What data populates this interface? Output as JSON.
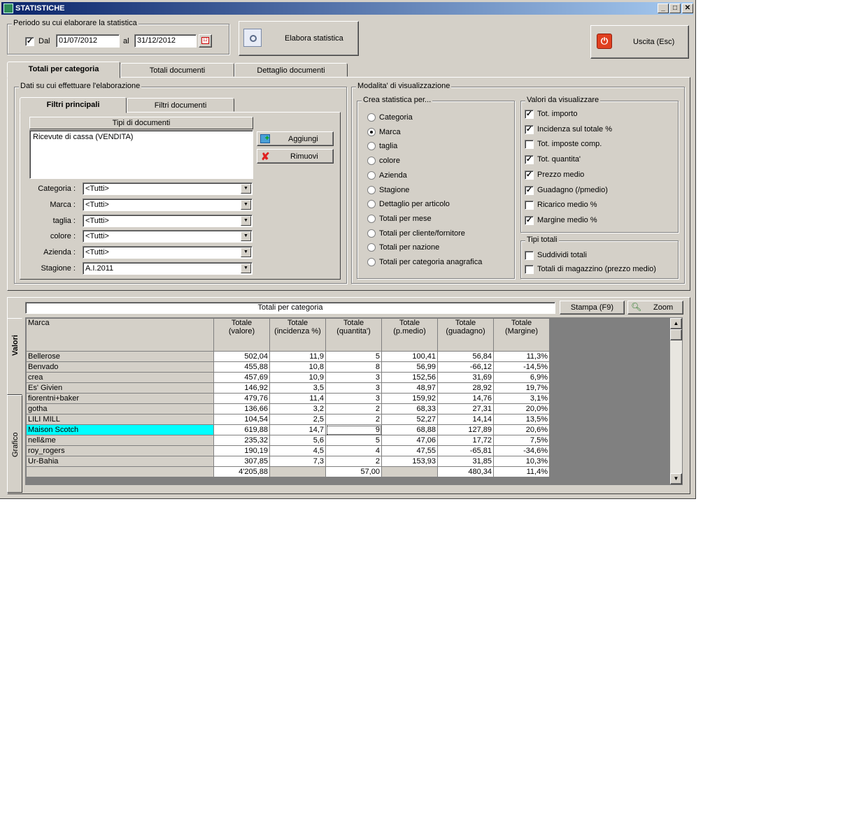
{
  "window": {
    "title": "STATISTICHE"
  },
  "period": {
    "group_label": "Periodo su cui elaborare la statistica",
    "from_label": "Dal",
    "from_checked": true,
    "from_value": "01/07/2012",
    "to_label": "al",
    "to_value": "31/12/2012"
  },
  "buttons": {
    "elabora": "Elabora statistica",
    "uscita": "Uscita (Esc)"
  },
  "main_tabs": [
    "Totali per categoria",
    "Totali documenti",
    "Dettaglio documenti"
  ],
  "dati": {
    "group_label": "Dati su cui effettuare l'elaborazione",
    "subtabs": [
      "Filtri principali",
      "Filtri documenti"
    ],
    "tipi_header": "Tipi di documenti",
    "tipi_items": [
      "Ricevute di cassa (VENDITA)"
    ],
    "aggiungi": "Aggiungi",
    "rimuovi": "Rimuovi",
    "filters": [
      {
        "label": "Categoria :",
        "value": "<Tutti>"
      },
      {
        "label": "Marca :",
        "value": "<Tutti>"
      },
      {
        "label": "taglia :",
        "value": "<Tutti>"
      },
      {
        "label": "colore :",
        "value": "<Tutti>"
      },
      {
        "label": "Azienda :",
        "value": "<Tutti>"
      },
      {
        "label": "Stagione :",
        "value": "A.I.2011"
      }
    ]
  },
  "modalita": {
    "group_label": "Modalita' di visualizzazione",
    "crea_label": "Crea statistica per...",
    "crea_options": [
      "Categoria",
      "Marca",
      "taglia",
      "colore",
      "Azienda",
      "Stagione",
      "Dettaglio per articolo",
      "Totali per mese",
      "Totali per cliente/fornitore",
      "Totali per nazione",
      "Totali per categoria anagrafica"
    ],
    "crea_selected": 1,
    "valori_label": "Valori da visualizzare",
    "valori_options": [
      {
        "label": "Tot. importo",
        "checked": true
      },
      {
        "label": "Incidenza sul totale %",
        "checked": true
      },
      {
        "label": "Tot. imposte comp.",
        "checked": false
      },
      {
        "label": "Tot. quantita'",
        "checked": true
      },
      {
        "label": "Prezzo medio",
        "checked": true
      },
      {
        "label": "Guadagno (/pmedio)",
        "checked": true
      },
      {
        "label": "Ricarico medio %",
        "checked": false
      },
      {
        "label": "Margine medio %",
        "checked": true
      }
    ],
    "tipi_totali_label": "Tipi totali",
    "tipi_totali_options": [
      {
        "label": "Suddividi totali",
        "checked": false
      },
      {
        "label": "Totali di magazzino (prezzo medio)",
        "checked": false
      }
    ]
  },
  "results": {
    "title": "Totali per categoria",
    "stampa": "Stampa (F9)",
    "zoom": "Zoom",
    "side_tabs": [
      "Valori",
      "Grafico"
    ],
    "columns": [
      "Marca",
      "Totale\n(valore)",
      "Totale\n(incidenza %)",
      "Totale\n(quantita')",
      "Totale\n(p.medio)",
      "Totale\n(guadagno)",
      "Totale\n(Margine)"
    ],
    "rows": [
      [
        "Bellerose",
        "502,04",
        "11,9",
        "5",
        "100,41",
        "56,84",
        "11,3%"
      ],
      [
        "Benvado",
        "455,88",
        "10,8",
        "8",
        "56,99",
        "-66,12",
        "-14,5%"
      ],
      [
        "crea",
        "457,69",
        "10,9",
        "3",
        "152,56",
        "31,69",
        "6,9%"
      ],
      [
        "Es' Givien",
        "146,92",
        "3,5",
        "3",
        "48,97",
        "28,92",
        "19,7%"
      ],
      [
        "fiorentni+baker",
        "479,76",
        "11,4",
        "3",
        "159,92",
        "14,76",
        "3,1%"
      ],
      [
        "gotha",
        "136,66",
        "3,2",
        "2",
        "68,33",
        "27,31",
        "20,0%"
      ],
      [
        "LILI MILL",
        "104,54",
        "2,5",
        "2",
        "52,27",
        "14,14",
        "13,5%"
      ],
      [
        "Maison Scotch",
        "619,88",
        "14,7",
        "9",
        "68,88",
        "127,89",
        "20,6%"
      ],
      [
        "nell&me",
        "235,32",
        "5,6",
        "5",
        "47,06",
        "17,72",
        "7,5%"
      ],
      [
        "roy_rogers",
        "190,19",
        "4,5",
        "4",
        "47,55",
        "-65,81",
        "-34,6%"
      ],
      [
        "Ur-Bahia",
        "307,85",
        "7,3",
        "2",
        "153,93",
        "31,85",
        "10,3%"
      ]
    ],
    "selected_row": 7,
    "totals": [
      "",
      "4'205,88",
      "",
      "57,00",
      "",
      "480,34",
      "11,4%"
    ]
  }
}
